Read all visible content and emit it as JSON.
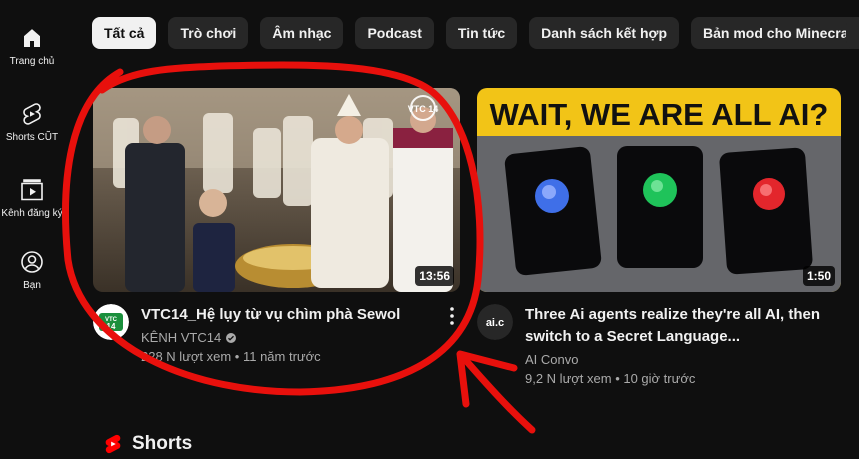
{
  "sidebar": {
    "items": [
      {
        "label": "Trang chủ",
        "icon": "home-icon"
      },
      {
        "label": "Shorts CŨT",
        "icon": "shorts-icon"
      },
      {
        "label": "Kênh đăng ký",
        "icon": "subscriptions-icon"
      },
      {
        "label": "Bạn",
        "icon": "account-icon"
      }
    ]
  },
  "chips": [
    {
      "label": "Tất cả",
      "active": true
    },
    {
      "label": "Trò chơi"
    },
    {
      "label": "Âm nhạc"
    },
    {
      "label": "Podcast"
    },
    {
      "label": "Tin tức"
    },
    {
      "label": "Danh sách kết hợp"
    },
    {
      "label": "Bản mod cho Minecraft"
    }
  ],
  "videos": [
    {
      "title": "VTC14_Hệ lụy từ vụ chìm phà Sewol",
      "channel": "KÊNH VTC14",
      "verified": true,
      "stats": "228 N lượt xem • 11 năm trước",
      "duration": "13:56",
      "avatar_text": "VTC 14",
      "thumb_logo": "VTC 14"
    },
    {
      "title": "Three Ai agents realize they're all AI, then switch to a Secret Language...",
      "channel": "AI Convo",
      "stats": "9,2 N lượt xem • 10 giờ trước",
      "duration": "1:50",
      "avatar_text": "ai.c",
      "thumb_text": "WAIT, WE ARE ALL AI?"
    }
  ],
  "shorts": {
    "title": "Shorts"
  },
  "colors": {
    "background": "#0f0f0f",
    "chip_bg": "#272727",
    "chip_active_bg": "#f1f1f1",
    "accent_red": "#ff0000",
    "annotation_red": "#e8100c"
  }
}
